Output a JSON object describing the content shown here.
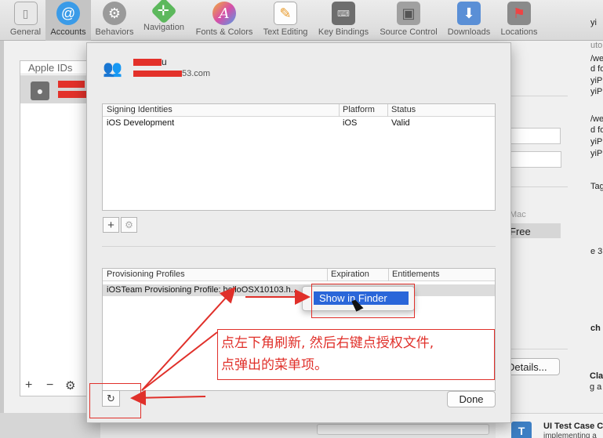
{
  "toolbar": {
    "items": [
      {
        "label": "General",
        "icon": "general-icon"
      },
      {
        "label": "Accounts",
        "icon": "at-sign-icon"
      },
      {
        "label": "Behaviors",
        "icon": "gear-icon"
      },
      {
        "label": "Navigation",
        "icon": "navigation-icon"
      },
      {
        "label": "Fonts & Colors",
        "icon": "fonts-colors-icon"
      },
      {
        "label": "Text Editing",
        "icon": "text-editing-icon"
      },
      {
        "label": "Key Bindings",
        "icon": "keyboard-icon"
      },
      {
        "label": "Source Control",
        "icon": "source-control-icon"
      },
      {
        "label": "Downloads",
        "icon": "downloads-icon"
      },
      {
        "label": "Locations",
        "icon": "locations-icon"
      }
    ]
  },
  "sidebar": {
    "header": "Apple IDs",
    "add_label": "+",
    "remove_label": "−",
    "settings_label": "⚙"
  },
  "account": {
    "name": "u",
    "email": "53.com"
  },
  "signing_identities": {
    "headers": [
      "Signing Identities",
      "Platform",
      "Status"
    ],
    "rows": [
      [
        "iOS Development",
        "iOS",
        "Valid"
      ]
    ]
  },
  "signing_buttons": {
    "add": "+",
    "settings": "⚙"
  },
  "provisioning_profiles": {
    "headers": [
      "Provisioning Profiles",
      "Expiration",
      "Entitlements"
    ],
    "rows": [
      [
        "iOSTeam Provisioning Profile: helloOSX10103.h...",
        "",
        ""
      ]
    ]
  },
  "context_menu": {
    "item": "Show in Finder"
  },
  "annotation": {
    "line1": "点左下角刷新, 然后右键点授权文件,",
    "line2": "点弹出的菜单项。"
  },
  "refresh_label": "↻",
  "done_label": "Done",
  "background": {
    "right_texts": [
      "yi",
      "uto",
      "/we",
      "d fo",
      "yiP",
      "yiP",
      "/we",
      "d fo",
      "yiP",
      "yiP",
      "Tag",
      "e 3",
      "ch",
      "Cla",
      "g a"
    ],
    "mac_label": "Mac",
    "free_label": "Free",
    "details_label": "Details...",
    "ui_test_title": "UI Test Case C",
    "ui_test_sub": "implementing a"
  },
  "colors": {
    "accent": "#2a66d9",
    "annotation_red": "#e0302a",
    "accounts_icon": "#3a9be8"
  }
}
